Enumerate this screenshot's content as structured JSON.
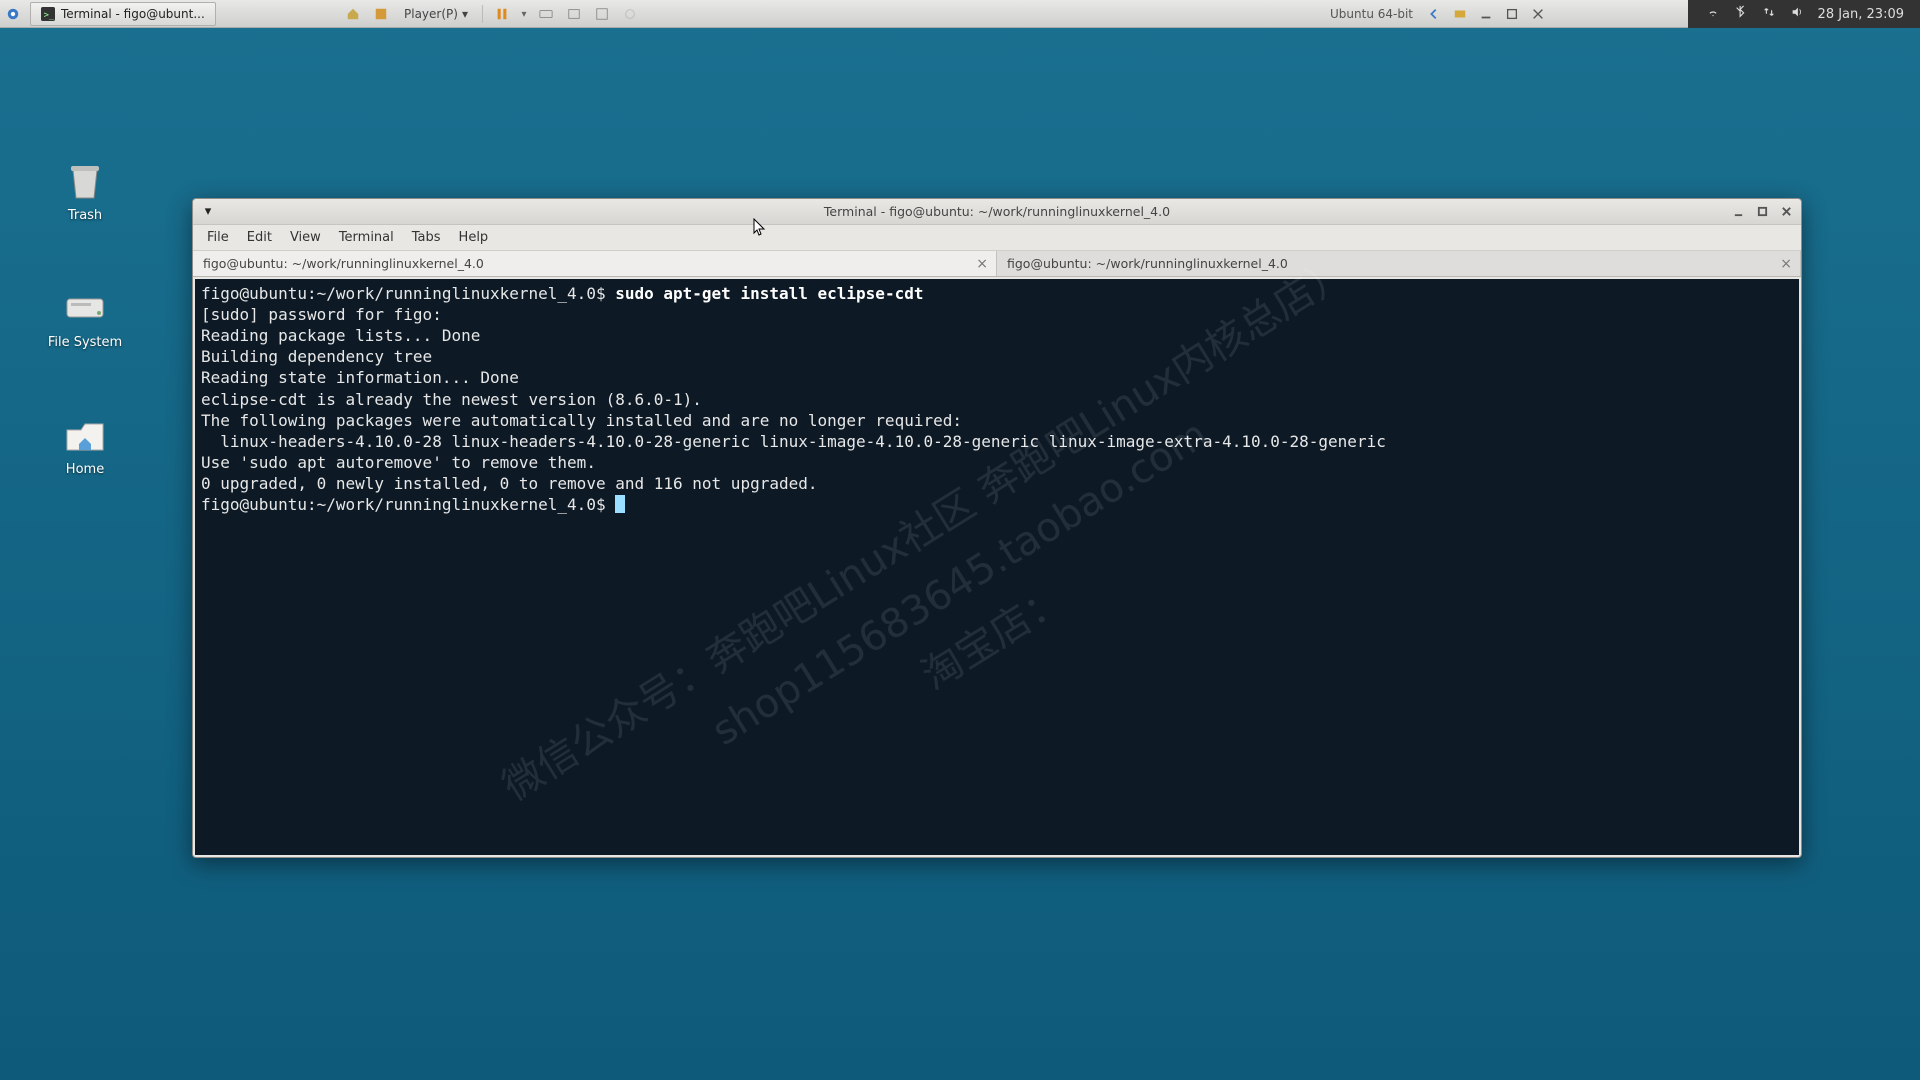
{
  "host_taskbar_app": "Terminal - figo@ubunt...",
  "vm": {
    "player_label": "Player(P)",
    "os_label": "Ubuntu 64-bit"
  },
  "host_clock": "28 Jan, 23:09",
  "desktop": {
    "trash": "Trash",
    "filesystem": "File System",
    "home": "Home"
  },
  "window": {
    "title": "Terminal - figo@ubuntu: ~/work/runninglinuxkernel_4.0",
    "menus": {
      "file": "File",
      "edit": "Edit",
      "view": "View",
      "terminal": "Terminal",
      "tabs": "Tabs",
      "help": "Help"
    },
    "tabs": [
      {
        "label": "figo@ubuntu: ~/work/runninglinuxkernel_4.0",
        "active": true
      },
      {
        "label": "figo@ubuntu: ~/work/runninglinuxkernel_4.0",
        "active": false
      }
    ]
  },
  "terminal": {
    "prompt1": "figo@ubuntu:~/work/runninglinuxkernel_4.0$ ",
    "command": "sudo apt-get install eclipse-cdt",
    "lines": [
      "[sudo] password for figo:",
      "Reading package lists... Done",
      "Building dependency tree",
      "Reading state information... Done",
      "eclipse-cdt is already the newest version (8.6.0-1).",
      "The following packages were automatically installed and are no longer required:",
      "  linux-headers-4.10.0-28 linux-headers-4.10.0-28-generic linux-image-4.10.0-28-generic linux-image-extra-4.10.0-28-generic",
      "Use 'sudo apt autoremove' to remove them.",
      "0 upgraded, 0 newly installed, 0 to remove and 116 not upgraded."
    ],
    "prompt2": "figo@ubuntu:~/work/runninglinuxkernel_4.0$ "
  },
  "watermark": {
    "l1": "微信公众号：奔跑吧Linux社区   奔跑吧Linux内核总店）",
    "l2": "shop115683645.taobao.com",
    "l3": "淘宝店："
  }
}
